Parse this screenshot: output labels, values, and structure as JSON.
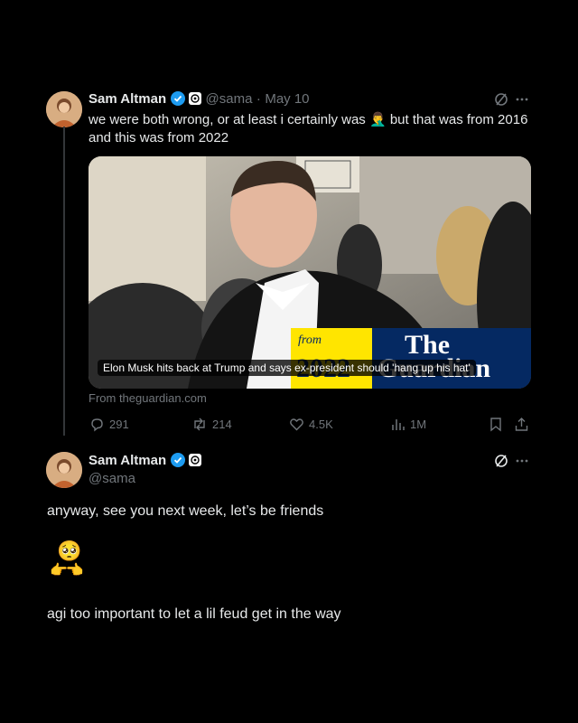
{
  "tweet1": {
    "author": "Sam Altman",
    "handle": "@sama",
    "separator": "·",
    "date": "May 10",
    "text_line1": "we were both wrong, or at least i certainly was",
    "emoji": "🤦‍♂️",
    "text_line1b": "but that was from 2016",
    "text_line2": "and this was from 2022",
    "card": {
      "caption": "Elon Musk hits back at Trump and says ex-president should 'hang up his hat'",
      "from_label": "from",
      "year_label": "2022",
      "brand_line1": "The",
      "brand_line2": "Guardian",
      "source": "From theguardian.com"
    },
    "stats": {
      "replies": "291",
      "reposts": "214",
      "likes": "4.5K",
      "views": "1M"
    }
  },
  "tweet2": {
    "author": "Sam Altman",
    "handle": "@sama",
    "line1": "anyway, see you next week, let’s be friends",
    "emoji": "🥺",
    "emoji2": "👉👈",
    "line2": "agi too important to let a lil feud get in the way"
  },
  "colors": {
    "background": "#000000",
    "text": "#e7e9ea",
    "muted": "#71767b",
    "verified": "#1d9bf0",
    "guardian_blue": "#052962",
    "guardian_yellow": "#ffe500"
  }
}
